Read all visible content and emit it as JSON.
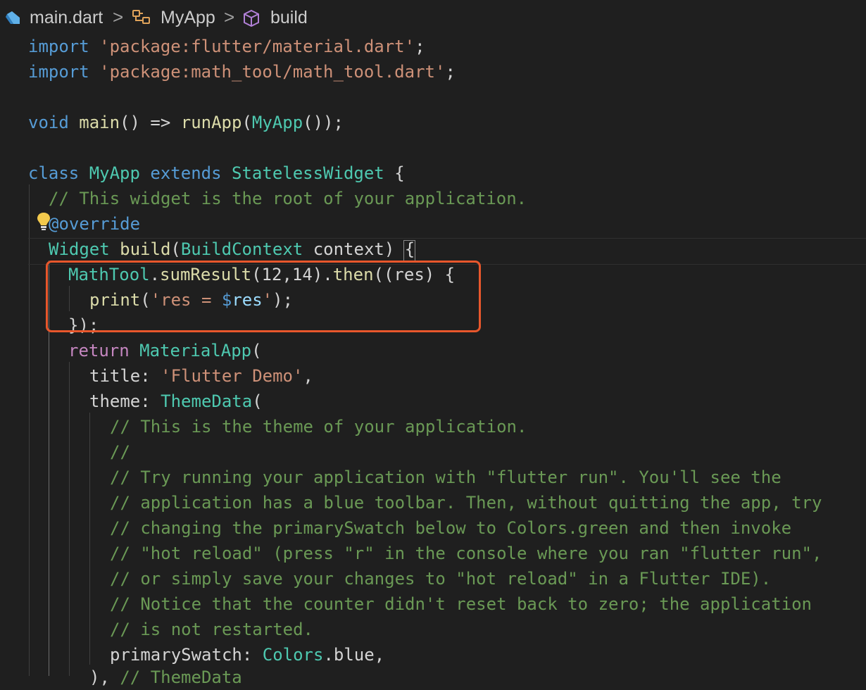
{
  "breadcrumb": {
    "file": "main.dart",
    "separator": ">",
    "class_name": "MyApp",
    "method_name": "build"
  },
  "colors": {
    "background": "#1f1f1f",
    "highlight_box": "#e8572c",
    "lightbulb": "#f2c94c"
  },
  "icons": {
    "file": "dart-file-icon",
    "class": "class-symbol-icon",
    "method": "method-cube-icon",
    "lightbulb": "lightbulb-icon"
  },
  "code": {
    "l0": [
      "import",
      " ",
      "'package:flutter/material.dart'",
      ";"
    ],
    "l1": [
      "import",
      " ",
      "'package:math_tool/math_tool.dart'",
      ";"
    ],
    "l3": [
      "void",
      " ",
      "main",
      "() => ",
      "runApp",
      "(",
      "MyApp",
      "());"
    ],
    "l5": [
      "class",
      " ",
      "MyApp",
      " ",
      "extends",
      " ",
      "StatelessWidget",
      " {"
    ],
    "l6": [
      "// This widget is the root of your application."
    ],
    "l7": [
      "@override"
    ],
    "l8": [
      "Widget",
      " ",
      "build",
      "(",
      "BuildContext",
      " ",
      "context",
      ") ",
      "{"
    ],
    "l9": [
      "MathTool",
      ".",
      "sumResult",
      "(",
      "12",
      ",",
      "14",
      ").",
      "then",
      "((",
      "res",
      ") {"
    ],
    "l10": [
      "print",
      "(",
      "'res = ",
      "$",
      "res",
      "'",
      ");"
    ],
    "l11": [
      "});"
    ],
    "l12": [
      "return",
      " ",
      "MaterialApp",
      "("
    ],
    "l13": [
      "title",
      ": ",
      "'Flutter Demo'",
      ","
    ],
    "l14": [
      "theme",
      ": ",
      "ThemeData",
      "("
    ],
    "l15": [
      "// This is the theme of your application."
    ],
    "l16": [
      "//"
    ],
    "l17": [
      "// Try running your application with \"flutter run\". You'll see the"
    ],
    "l18": [
      "// application has a blue toolbar. Then, without quitting the app, try"
    ],
    "l19": [
      "// changing the primarySwatch below to Colors.green and then invoke"
    ],
    "l20": [
      "// \"hot reload\" (press \"r\" in the console where you ran \"flutter run\","
    ],
    "l21": [
      "// or simply save your changes to \"hot reload\" in a Flutter IDE)."
    ],
    "l22": [
      "// Notice that the counter didn't reset back to zero; the application"
    ],
    "l23": [
      "// is not restarted."
    ],
    "l24": [
      "primarySwatch",
      ": ",
      "Colors",
      ".",
      "blue",
      ","
    ],
    "l25": [
      "),",
      " ",
      "// ThemeData"
    ]
  }
}
